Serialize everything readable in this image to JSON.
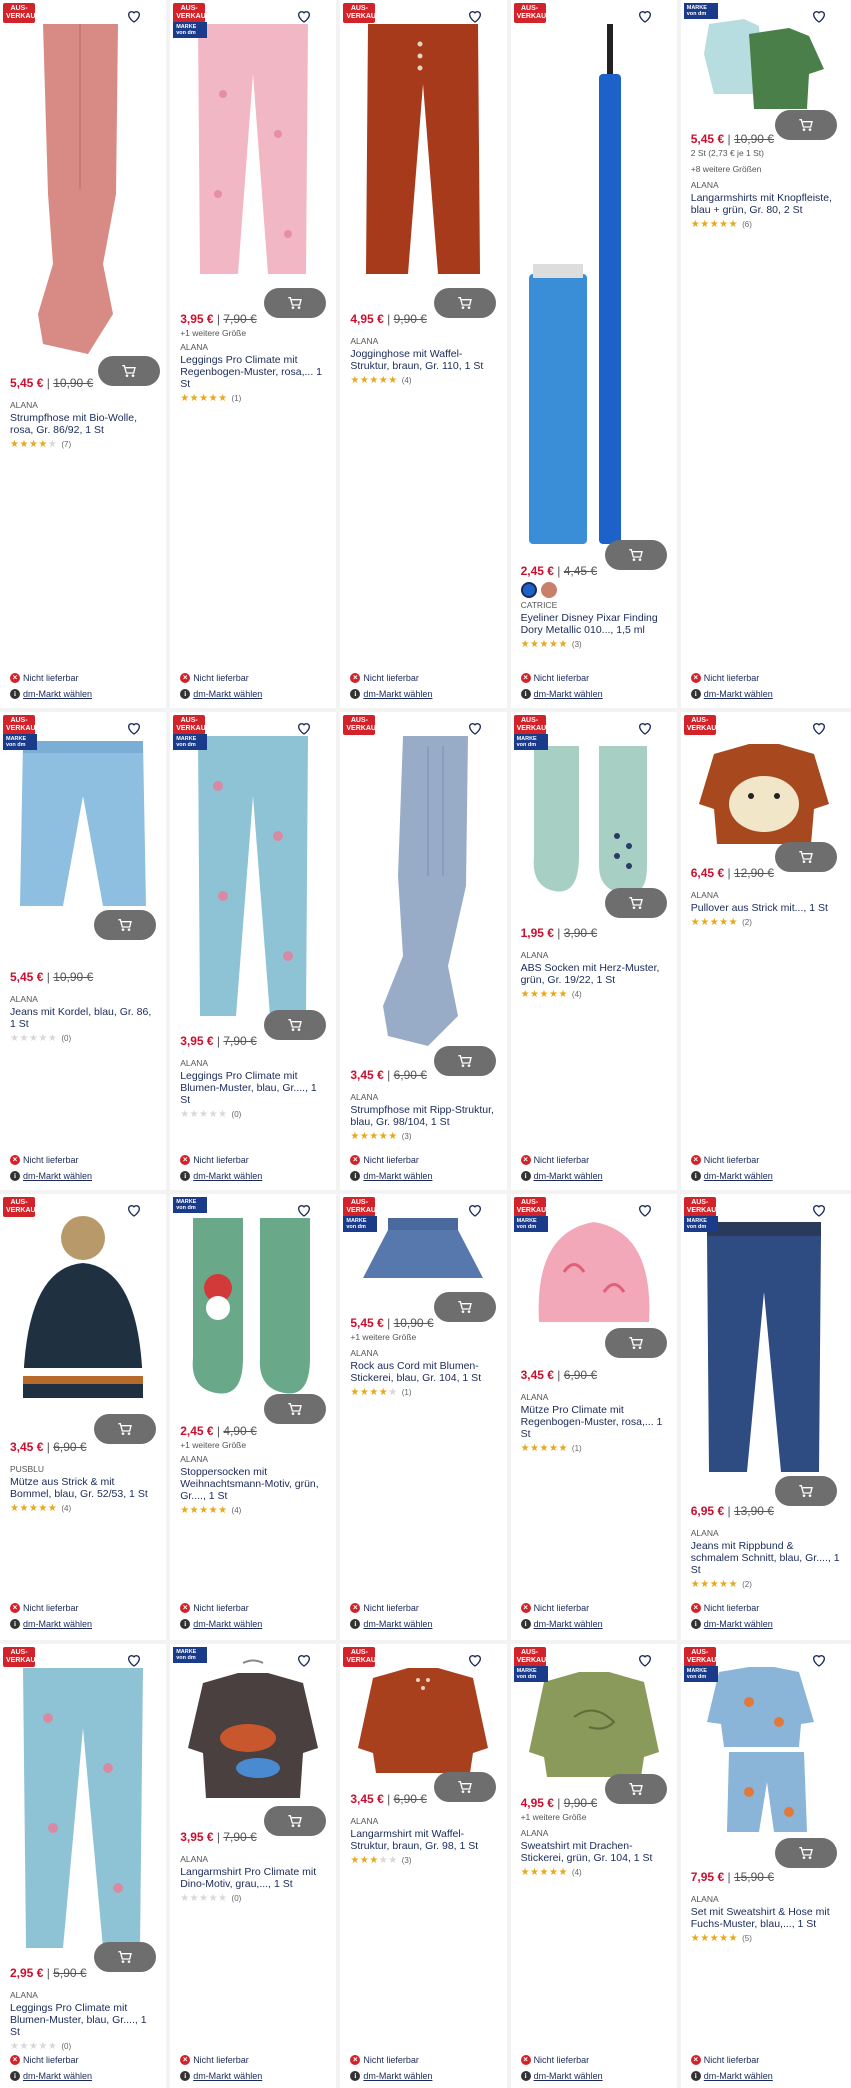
{
  "badges": {
    "sale": "AUS-\nVERKAUF",
    "brand": "MARKE\nvon dm"
  },
  "availability": {
    "unavailable": "Nicht lieferbar",
    "choose_market": "dm-Markt wählen"
  },
  "colors": {
    "price_red": "#c8102e",
    "star_gold": "#e9a817",
    "cart_gray": "#6e6e6e",
    "sale_red": "#d2232a",
    "brand_blue": "#1a3a8a"
  },
  "products": [
    {
      "price": "5,45 €",
      "old_price": "10,90 €",
      "brand": "ALANA",
      "name": "Strumpfhose mit Bio-Wolle, rosa, Gr. 86/92, 1 St",
      "rating": 4,
      "reviews": "(7)",
      "icon": "tights-icon"
    },
    {
      "price": "3,95 €",
      "old_price": "7,90 €",
      "more": "+1 weitere Größe",
      "brand": "ALANA",
      "name": "Leggings Pro Climate mit Regenbogen-Muster, rosa,... 1 St",
      "rating": 5,
      "reviews": "(1)",
      "icon": "leggings-icon"
    },
    {
      "price": "4,95 €",
      "old_price": "9,90 €",
      "brand": "ALANA",
      "name": "Jogginghose mit Waffel-Struktur, braun, Gr. 110, 1 St",
      "rating": 5,
      "reviews": "(4)",
      "icon": "pants-icon"
    },
    {
      "price": "2,45 €",
      "old_price": "4,45 €",
      "brand": "Catrice",
      "name": "Eyeliner Disney Pixar Finding Dory Metallic 010..., 1,5 ml",
      "rating": 5,
      "reviews": "(3)",
      "icon": "eyeliner-icon"
    },
    {
      "price": "5,45 €",
      "old_price": "10,90 €",
      "unit": "2 St (2,73 € je 1 St)",
      "more": "+8 weitere Größen",
      "brand": "ALANA",
      "name": "Langarmshirts mit Knopfleiste, blau + grün, Gr. 80, 2 St",
      "rating": 5,
      "reviews": "(6)",
      "icon": "shirts-icon"
    },
    {
      "price": "5,45 €",
      "old_price": "10,90 €",
      "brand": "ALANA",
      "name": "Jeans mit Kordel, blau, Gr. 86, 1 St",
      "rating": 0,
      "reviews": "(0)",
      "icon": "jeans-icon"
    },
    {
      "price": "3,95 €",
      "old_price": "7,90 €",
      "brand": "ALANA",
      "name": "Leggings Pro Climate mit Blumen-Muster, blau, Gr...., 1 St",
      "rating": 0,
      "reviews": "(0)",
      "icon": "leggings-icon"
    },
    {
      "price": "3,45 €",
      "old_price": "6,90 €",
      "brand": "ALANA",
      "name": "Strumpfhose mit Ripp-Struktur, blau, Gr. 98/104, 1 St",
      "rating": 5,
      "reviews": "(3)",
      "icon": "tights-icon"
    },
    {
      "price": "1,95 €",
      "old_price": "3,90 €",
      "brand": "ALANA",
      "name": "ABS Socken mit Herz-Muster, grün, Gr. 19/22, 1 St",
      "rating": 5,
      "reviews": "(4)",
      "icon": "socks-icon"
    },
    {
      "price": "6,45 €",
      "old_price": "12,90 €",
      "brand": "ALANA",
      "name": "Pullover aus Strick mit..., 1 St",
      "rating": 5,
      "reviews": "(2)",
      "icon": "sweater-icon"
    },
    {
      "price": "3,45 €",
      "old_price": "6,90 €",
      "brand": "PUSBLU",
      "name": "Mütze aus Strick & mit Bommel, blau, Gr. 52/53, 1 St",
      "rating": 5,
      "reviews": "(4)",
      "icon": "beanie-icon"
    },
    {
      "price": "2,45 €",
      "old_price": "4,90 €",
      "more": "+1 weitere Größe",
      "brand": "ALANA",
      "name": "Stoppersocken mit Weihnachtsmann-Motiv, grün, Gr...., 1 St",
      "rating": 5,
      "reviews": "(4)",
      "icon": "socks-icon"
    },
    {
      "price": "5,45 €",
      "old_price": "10,90 €",
      "more": "+1 weitere Größe",
      "brand": "ALANA",
      "name": "Rock aus Cord mit Blumen-Stickerei, blau, Gr. 104, 1 St",
      "rating": 4,
      "reviews": "(1)",
      "icon": "skirt-icon"
    },
    {
      "price": "3,45 €",
      "old_price": "6,90 €",
      "brand": "ALANA",
      "name": "Mütze Pro Climate mit Regenbogen-Muster, rosa,... 1 St",
      "rating": 5,
      "reviews": "(1)",
      "icon": "beanie-icon"
    },
    {
      "price": "6,95 €",
      "old_price": "13,90 €",
      "brand": "ALANA",
      "name": "Jeans mit Rippbund & schmalem Schnitt, blau, Gr...., 1 St",
      "rating": 5,
      "reviews": "(2)",
      "icon": "jeans-icon"
    },
    {
      "price": "2,95 €",
      "old_price": "5,90 €",
      "brand": "ALANA",
      "name": "Leggings Pro Climate mit Blumen-Muster, blau, Gr...., 1 St",
      "rating": 0,
      "reviews": "(0)",
      "icon": "leggings-icon"
    },
    {
      "price": "3,95 €",
      "old_price": "7,90 €",
      "brand": "ALANA",
      "name": "Langarmshirt Pro Climate mit Dino-Motiv, grau,..., 1 St",
      "rating": 0,
      "reviews": "(0)",
      "icon": "shirt-icon"
    },
    {
      "price": "3,45 €",
      "old_price": "6,90 €",
      "brand": "ALANA",
      "name": "Langarmshirt mit Waffel-Struktur, braun, Gr. 98, 1 St",
      "rating": 3,
      "reviews": "(3)",
      "icon": "shirt-icon"
    },
    {
      "price": "4,95 €",
      "old_price": "9,90 €",
      "more": "+1 weitere Größe",
      "brand": "ALANA",
      "name": "Sweatshirt mit Drachen-Stickerei, grün, Gr. 104, 1 St",
      "rating": 5,
      "reviews": "(4)",
      "icon": "sweatshirt-icon"
    },
    {
      "price": "7,95 €",
      "old_price": "15,90 €",
      "brand": "ALANA",
      "name": "Set mit Sweatshirt & Hose mit Fuchs-Muster, blau,..., 1 St",
      "rating": 5,
      "reviews": "(5)",
      "icon": "set-icon"
    }
  ]
}
